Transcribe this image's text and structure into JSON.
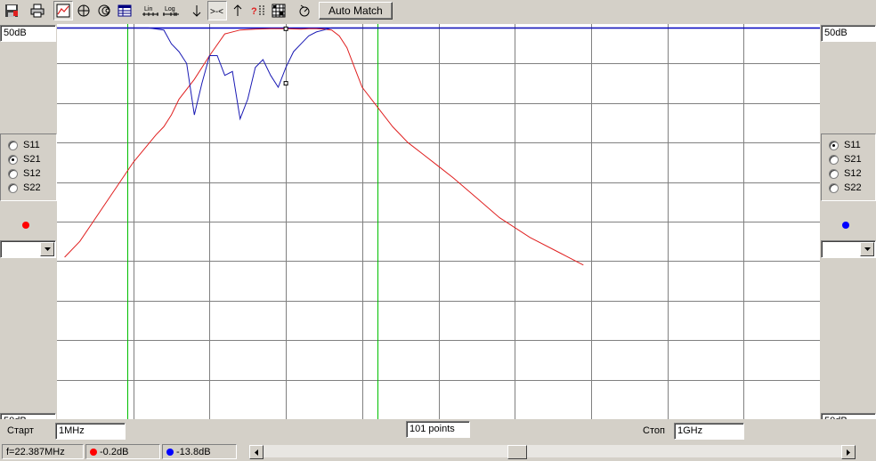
{
  "toolbar": {
    "buttons": [
      "save-icon",
      "print-icon",
      "chart-icon",
      "polar-icon",
      "smith-icon",
      "table-icon",
      "lin-icon",
      "log-icon",
      "marker-down-icon",
      "marker-center-icon",
      "marker-up-icon",
      "help-marker-icon",
      "grid-icon",
      "measure-icon"
    ],
    "lin_label": "Lin",
    "log_label": "Log",
    "center_label": ">-<",
    "auto_match_label": "Auto Match"
  },
  "left_panel": {
    "scale_top": "50dB",
    "params": [
      "S11",
      "S21",
      "S12",
      "S22"
    ],
    "selected": "S21",
    "marker_color": "#ff0000",
    "scale_bottom": "50dB"
  },
  "right_panel": {
    "scale_top": "50dB",
    "params": [
      "S11",
      "S21",
      "S12",
      "S22"
    ],
    "selected": "S11",
    "marker_color": "#0000ff",
    "scale_bottom": "50dB"
  },
  "sweep": {
    "start_label": "Старт",
    "start_value": "1MHz",
    "points_value": "101 points",
    "stop_label": "Стоп",
    "stop_value": "1GHz"
  },
  "status": {
    "frequency": "f=22.387MHz",
    "red_value": "-0.2dB",
    "blue_value": "-13.8dB"
  },
  "colors": {
    "s21_trace": "#e02020",
    "s11_trace": "#1a1ab4",
    "reference": "#0000c0",
    "limit_lines": "#00c000",
    "grid": "#808080"
  },
  "chart_data": {
    "type": "line",
    "grid": true,
    "series": [
      {
        "name": "S21",
        "x": [
          1,
          3,
          10,
          13,
          14,
          15,
          16,
          18,
          20,
          22,
          24,
          26,
          28,
          30,
          32,
          33,
          34,
          35,
          36,
          37,
          38,
          39,
          40,
          42,
          44,
          46,
          48,
          50,
          52,
          55,
          58,
          62,
          66,
          69
        ],
        "y": [
          -58,
          -54,
          -34,
          -27,
          -25,
          -22,
          -18,
          -13,
          -7,
          -1.5,
          -0.5,
          -0.3,
          -0.2,
          -0.2,
          -0.3,
          -0.2,
          -0.2,
          -0.3,
          -0.5,
          -2,
          -5,
          -10,
          -15,
          -20,
          -25,
          -29,
          -32,
          -35,
          -38,
          -43,
          -48,
          -53,
          -57,
          -60
        ]
      },
      {
        "name": "S11",
        "x": [
          0,
          10,
          12,
          14,
          15,
          16,
          17,
          18,
          19,
          20,
          21,
          22,
          23,
          24,
          25,
          26,
          27,
          28,
          29,
          30,
          31,
          32,
          33,
          34,
          35,
          36,
          38,
          40,
          50,
          60,
          75
        ],
        "y": [
          0,
          0,
          0,
          -0.5,
          -4,
          -6,
          -9,
          -22,
          -14,
          -7,
          -7,
          -12,
          -11,
          -23,
          -18,
          -10,
          -8,
          -12,
          -15,
          -10,
          -6,
          -4,
          -2,
          -1,
          -0.5,
          0,
          0,
          0,
          0,
          0,
          0
        ]
      }
    ],
    "limit_lines_x": [
      9.2,
      42
    ]
  }
}
